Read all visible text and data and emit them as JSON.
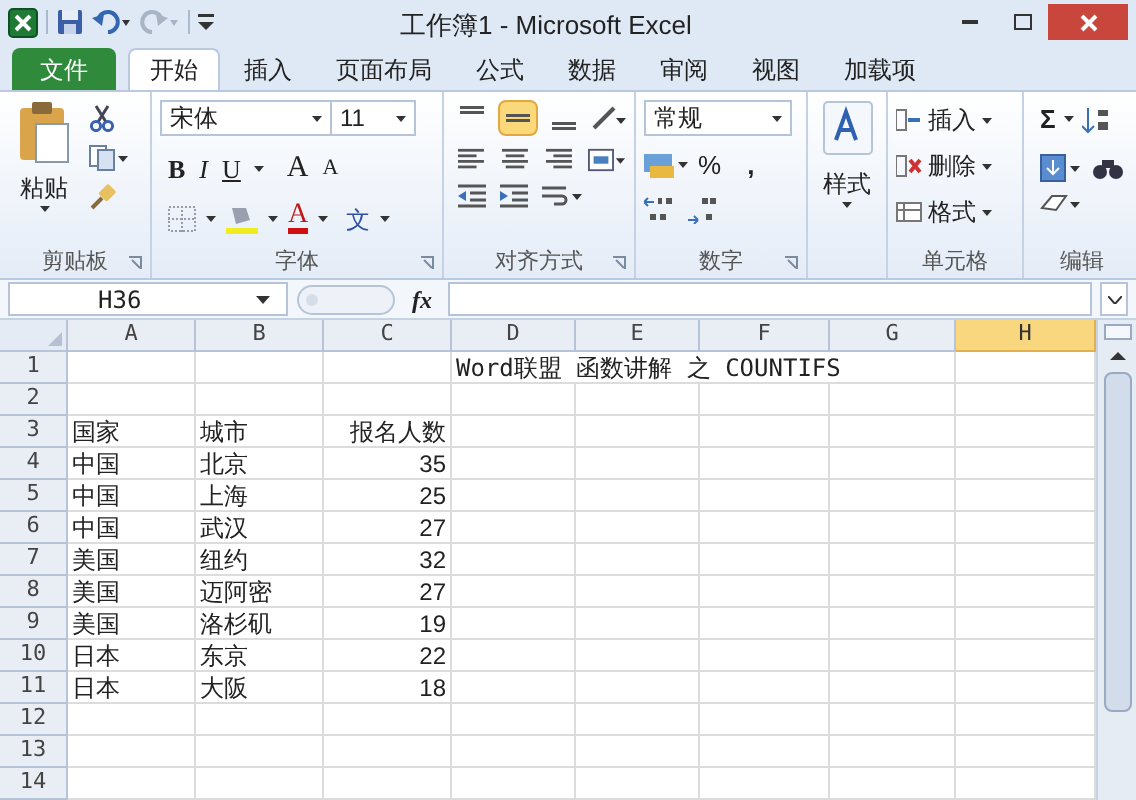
{
  "window": {
    "title": "工作簿1  -  Microsoft Excel"
  },
  "tabs": [
    {
      "label": "文件",
      "kind": "file",
      "selected": false
    },
    {
      "label": "开始",
      "kind": "tab",
      "selected": true
    },
    {
      "label": "插入",
      "kind": "tab",
      "selected": false
    },
    {
      "label": "页面布局",
      "kind": "tab",
      "selected": false
    },
    {
      "label": "公式",
      "kind": "tab",
      "selected": false
    },
    {
      "label": "数据",
      "kind": "tab",
      "selected": false
    },
    {
      "label": "审阅",
      "kind": "tab",
      "selected": false
    },
    {
      "label": "视图",
      "kind": "tab",
      "selected": false
    },
    {
      "label": "加载项",
      "kind": "tab",
      "selected": false
    }
  ],
  "ribbon": {
    "clipboard": {
      "paste": "粘贴",
      "label": "剪贴板"
    },
    "font": {
      "font_name": "宋体",
      "font_size": "11",
      "bold": "B",
      "italic": "I",
      "underline": "U",
      "grow": "A",
      "shrink": "A",
      "phonetic": "文",
      "font_color": "A",
      "label": "字体"
    },
    "alignment": {
      "vertical": [
        {
          "selected": false
        },
        {
          "selected": true
        },
        {
          "selected": false
        }
      ],
      "label": "对齐方式"
    },
    "number": {
      "format": "常规",
      "percent": "%",
      "comma": ",",
      "label": "数字"
    },
    "styles": {
      "button": "样式"
    },
    "cells": {
      "insert": "插入",
      "delete": "删除",
      "format": "格式",
      "label": "单元格"
    },
    "editing": {
      "sum": "Σ",
      "label": "编辑"
    }
  },
  "formula_bar": {
    "name_box": "H36",
    "fx": "fx"
  },
  "sheet": {
    "columns": [
      {
        "label": "A",
        "selected": false
      },
      {
        "label": "B",
        "selected": false
      },
      {
        "label": "C",
        "selected": false
      },
      {
        "label": "D",
        "selected": false
      },
      {
        "label": "E",
        "selected": false
      },
      {
        "label": "F",
        "selected": false
      },
      {
        "label": "G",
        "selected": false
      },
      {
        "label": "H",
        "selected": true
      }
    ],
    "rows": [
      {
        "number": "1",
        "title": "Word联盟 函数讲解 之  COUNTIFS"
      },
      {
        "number": "2"
      },
      {
        "number": "3",
        "country": "国家",
        "city": "城市",
        "count": "报名人数"
      },
      {
        "number": "4",
        "country": "中国",
        "city": "北京",
        "count": "35"
      },
      {
        "number": "5",
        "country": "中国",
        "city": "上海",
        "count": "25"
      },
      {
        "number": "6",
        "country": "中国",
        "city": "武汉",
        "count": "27"
      },
      {
        "number": "7",
        "country": "美国",
        "city": "纽约",
        "count": "32"
      },
      {
        "number": "8",
        "country": "美国",
        "city": "迈阿密",
        "count": "27"
      },
      {
        "number": "9",
        "country": "美国",
        "city": "洛杉矶",
        "count": "19"
      },
      {
        "number": "10",
        "country": "日本",
        "city": "东京",
        "count": "22"
      },
      {
        "number": "11",
        "country": "日本",
        "city": "大阪",
        "count": "18"
      },
      {
        "number": "12"
      },
      {
        "number": "13"
      },
      {
        "number": "14"
      }
    ]
  }
}
